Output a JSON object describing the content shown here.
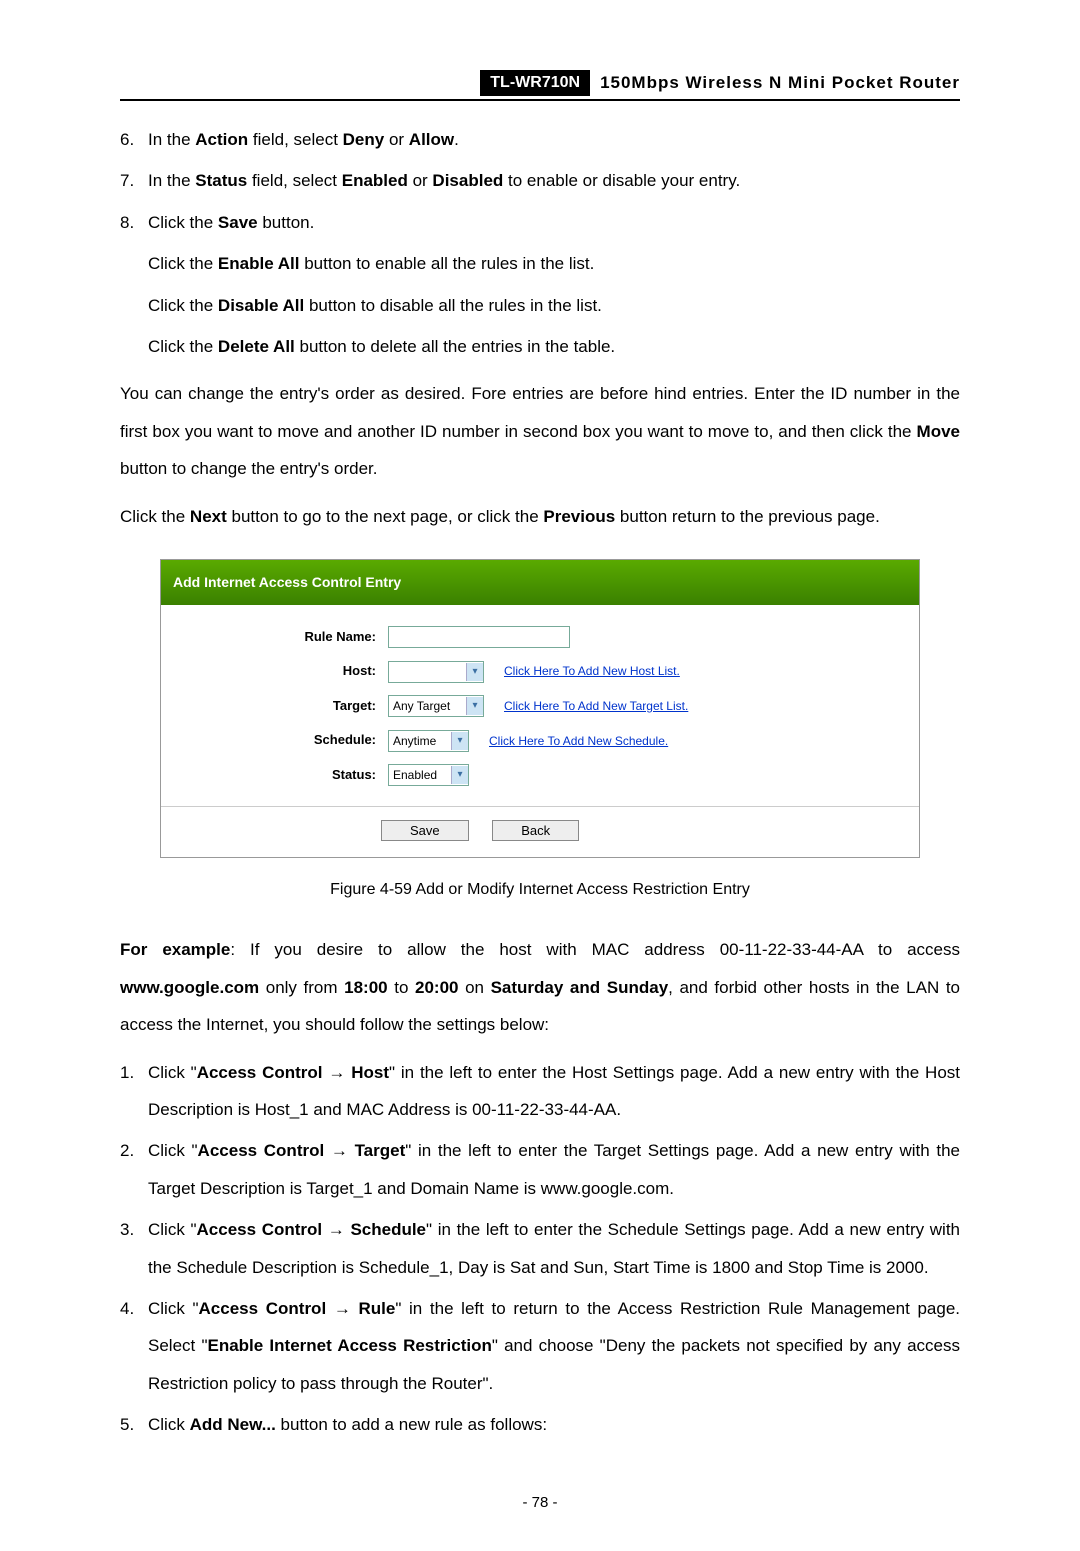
{
  "header": {
    "model": "TL-WR710N",
    "product": "150Mbps Wireless N Mini Pocket Router"
  },
  "steps_top": [
    {
      "num": "6.",
      "pre": "In the ",
      "b1": "Action",
      "mid1": " field, select ",
      "b2": "Deny",
      "mid2": " or ",
      "b3": "Allow",
      "post": "."
    },
    {
      "num": "7.",
      "pre": "In the ",
      "b1": "Status",
      "mid1": " field, select ",
      "b2": "Enabled",
      "mid2": " or ",
      "b3": "Disabled",
      "post": " to enable or disable your entry."
    },
    {
      "num": "8.",
      "pre": " Click the ",
      "b1": "Save",
      "post": " button."
    }
  ],
  "sub_clicks": [
    {
      "pre": "Click the ",
      "b": "Enable All",
      "post": " button to enable all the rules in the list."
    },
    {
      "pre": "Click the ",
      "b": "Disable All",
      "post": " button to disable all the rules in the list."
    },
    {
      "pre": "Click the ",
      "b": "Delete All",
      "post": " button to delete all the entries in the table."
    }
  ],
  "para1": {
    "pre": "You can change the entry's order as desired. Fore entries are before hind entries. Enter the ID number in the first box you want to move and another ID number in second box you want to move to, and then click the ",
    "b": "Move",
    "post": " button to change the entry's order."
  },
  "para2": {
    "pre": "Click the ",
    "b1": "Next",
    "mid": " button to go to the next page, or click the ",
    "b2": "Previous",
    "post": " button return to the previous page."
  },
  "figure": {
    "header": "Add Internet Access Control Entry",
    "rows": {
      "rule_name": "Rule Name:",
      "host": "Host:",
      "target": "Target:",
      "schedule": "Schedule:",
      "status": "Status:"
    },
    "dropdowns": {
      "target_val": "Any Target",
      "schedule_val": "Anytime",
      "status_val": "Enabled"
    },
    "links": {
      "host": "Click Here To Add New Host List.",
      "target": "Click Here To Add New Target List.",
      "schedule": "Click Here To Add New Schedule."
    },
    "buttons": {
      "save": "Save",
      "back": "Back"
    },
    "caption": "Figure 4-59    Add or Modify Internet Access Restriction Entry"
  },
  "example": {
    "label": "For example",
    "pre": ": If you desire to allow the host with MAC address 00-11-22-33-44-AA to access ",
    "b1": "www.google.com",
    "mid1": " only from ",
    "b2": "18:00",
    "mid2": " to ",
    "b3": "20:00",
    "mid3": " on ",
    "b4": "Saturday and Sunday",
    "post": ", and forbid other hosts in the LAN to access the Internet, you should follow the settings below:"
  },
  "steps_bottom": [
    {
      "num": "1.",
      "pre": "Click \"",
      "b1": "Access Control",
      "arrow": " → ",
      "b2": "Host",
      "post": "\" in the left to enter the Host Settings page. Add a new entry with the Host Description is Host_1 and MAC Address is 00-11-22-33-44-AA."
    },
    {
      "num": "2.",
      "pre": "Click \"",
      "b1": "Access Control",
      "arrow": " → ",
      "b2": "Target",
      "post": "\" in the left to enter the Target Settings page. Add a new entry with the Target Description is Target_1 and Domain Name is www.google.com."
    },
    {
      "num": "3.",
      "pre": "Click \"",
      "b1": "Access Control",
      "arrow": " → ",
      "b2": "Schedule",
      "post": "\" in the left to enter the Schedule Settings page. Add a new entry with the Schedule Description is Schedule_1, Day is Sat and Sun, Start Time is 1800 and Stop Time is 2000."
    },
    {
      "num": "4.",
      "pre": "Click \"",
      "b1": "Access Control",
      "arrow": " → ",
      "b2": "Rule",
      "mid": "\" in the left to return to the Access Restriction Rule Management page. Select \"",
      "b3": "Enable Internet Access Restriction",
      "post": "\" and choose \"Deny the packets not specified by any access Restriction policy to pass through the Router\"."
    },
    {
      "num": "5.",
      "pre": "Click ",
      "b1": "Add New...",
      "post": " button to add a new rule as follows:"
    }
  ],
  "page_number": "- 78 -"
}
